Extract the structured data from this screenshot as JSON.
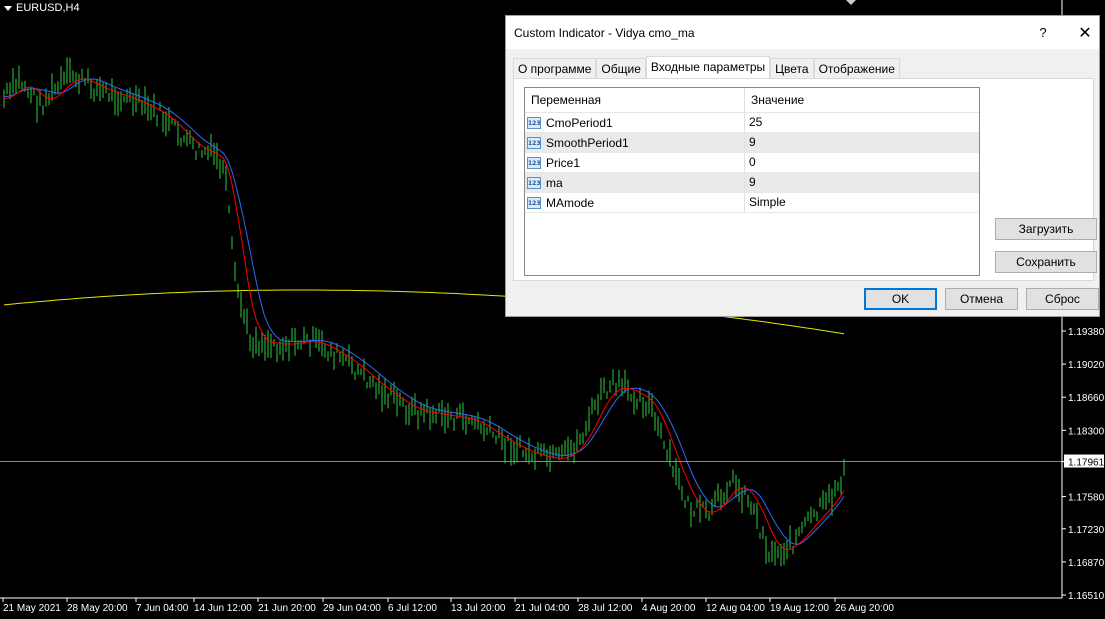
{
  "chart": {
    "symbol_label": "EURUSD,H4",
    "price_labels": [
      "1.19380",
      "1.19020",
      "1.18660",
      "1.18300",
      "1.17961",
      "1.17580",
      "1.17230",
      "1.16870",
      "1.16510"
    ],
    "current_price": "1.17961",
    "time_labels": [
      "21 May 2021",
      "28 May 20:00",
      "7 Jun 04:00",
      "14 Jun 12:00",
      "21 Jun 20:00",
      "29 Jun 04:00",
      "6 Jul 12:00",
      "13 Jul 20:00",
      "21 Jul 04:00",
      "28 Jul 12:00",
      "4 Aug 20:00",
      "12 Aug 04:00",
      "19 Aug 12:00",
      "26 Aug 20:00"
    ],
    "colors": {
      "candles": "#2ecc40",
      "vidya": "#ff0000",
      "ma": "#3366ff",
      "long_ma": "#e6e600",
      "current_line": "#6a8cc0",
      "axis": "#ffffff"
    }
  },
  "dialog": {
    "title": "Custom Indicator - Vidya cmo_ma",
    "help_label": "?",
    "close_label": "✕",
    "tabs": [
      {
        "label": "О программе",
        "active": false
      },
      {
        "label": "Общие",
        "active": false
      },
      {
        "label": "Входные параметры",
        "active": true
      },
      {
        "label": "Цвета",
        "active": false
      },
      {
        "label": "Отображение",
        "active": false
      }
    ],
    "grid": {
      "col_variable": "Переменная",
      "col_value": "Значение",
      "rows": [
        {
          "icon": "123",
          "name": "CmoPeriod1",
          "value": "25"
        },
        {
          "icon": "123",
          "name": "SmoothPeriod1",
          "value": "9"
        },
        {
          "icon": "123",
          "name": "Price1",
          "value": "0"
        },
        {
          "icon": "123",
          "name": "ma",
          "value": "9"
        },
        {
          "icon": "123",
          "name": "MAmode",
          "value": "Simple"
        }
      ]
    },
    "load_label": "Загрузить",
    "save_label": "Сохранить",
    "ok_label": "OK",
    "cancel_label": "Отмена",
    "reset_label": "Сброс"
  }
}
